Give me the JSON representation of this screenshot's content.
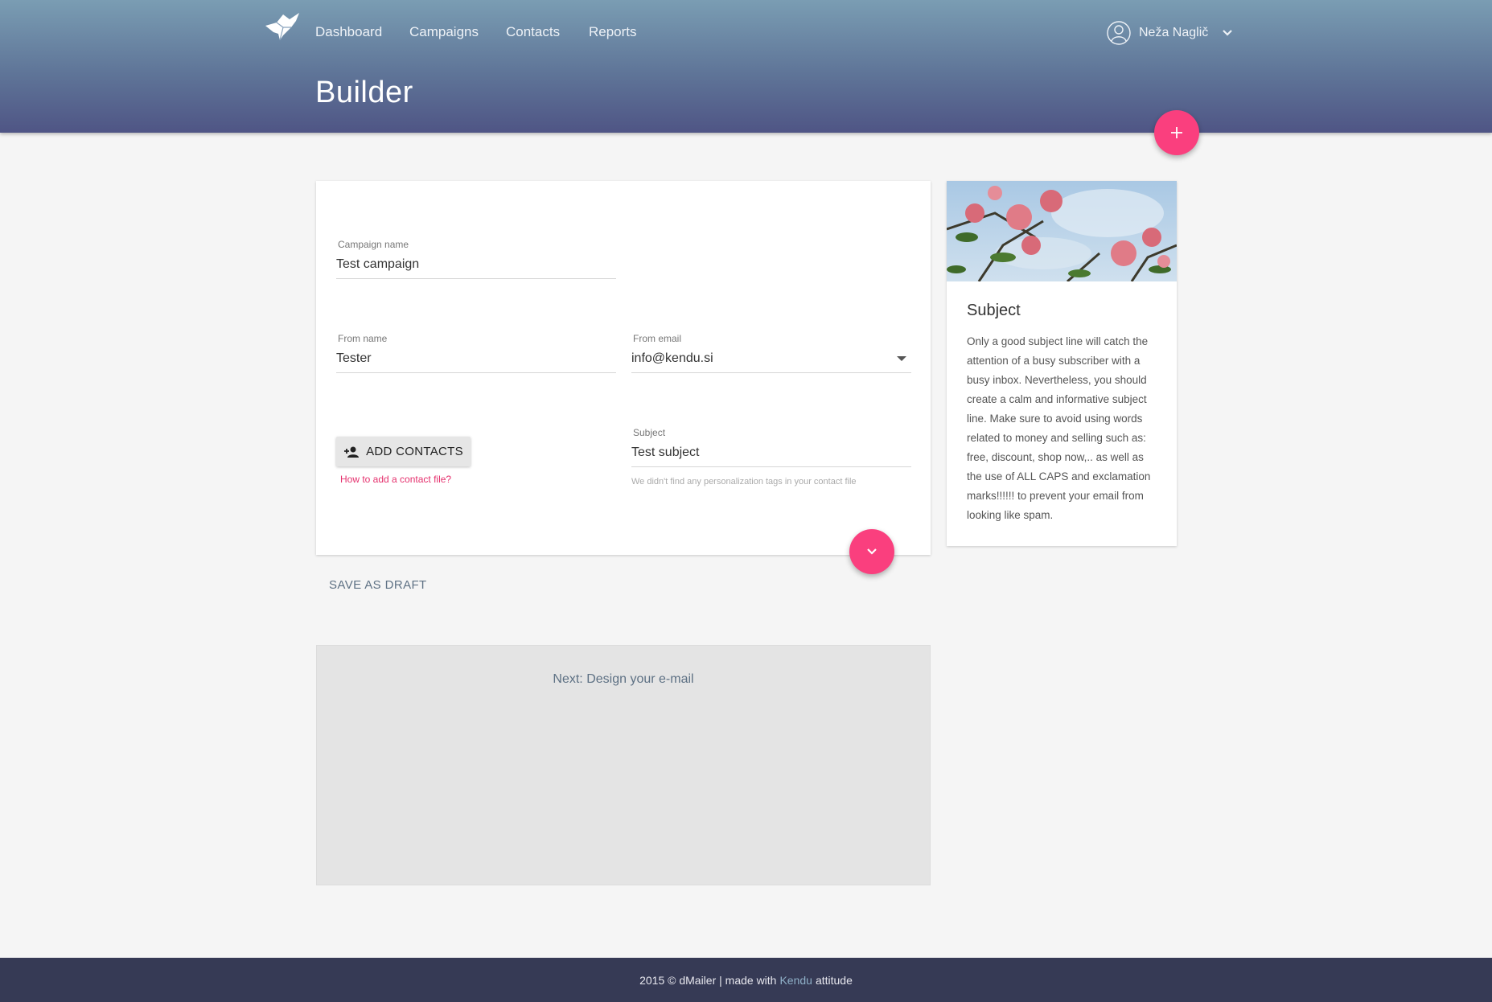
{
  "header": {
    "nav": [
      "Dashboard",
      "Campaigns",
      "Contacts",
      "Reports"
    ],
    "user_name": "Neža Naglič",
    "page_title": "Builder"
  },
  "form": {
    "campaign_name": {
      "label": "Campaign name",
      "value": "Test campaign"
    },
    "from_name": {
      "label": "From name",
      "value": "Tester"
    },
    "from_email": {
      "label": "From email",
      "value": "info@kendu.si"
    },
    "subject": {
      "label": "Subject",
      "value": "Test subject",
      "hint": "We didn't find any personalization tags in your contact file"
    },
    "add_contacts_label": "ADD CONTACTS",
    "help_link": "How to add a contact file?"
  },
  "save_draft": "SAVE AS DRAFT",
  "next_step": "Next: Design your e-mail",
  "info": {
    "title": "Subject",
    "body": "Only a good subject line will catch the attention of a busy subscriber with a busy inbox. Nevertheless, you should create a calm and informative subject line. Make sure to avoid using words related to money and selling such as: free, discount, shop now,.. as well as the use of ALL CAPS and exclamation marks!!!!!! to prevent your email from looking like spam."
  },
  "footer": {
    "prefix": "2015 © dMailer | made with",
    "brand": "Kendu",
    "suffix": "attitude"
  },
  "colors": {
    "accent": "#fa3f7e",
    "header_top": "#7a9db3",
    "header_bottom": "#4f5585",
    "footer": "#363a55"
  },
  "icons": [
    "bird-logo-icon",
    "user-icon",
    "chevron-down-icon",
    "plus-icon",
    "add-person-icon",
    "dropdown-caret-icon"
  ]
}
